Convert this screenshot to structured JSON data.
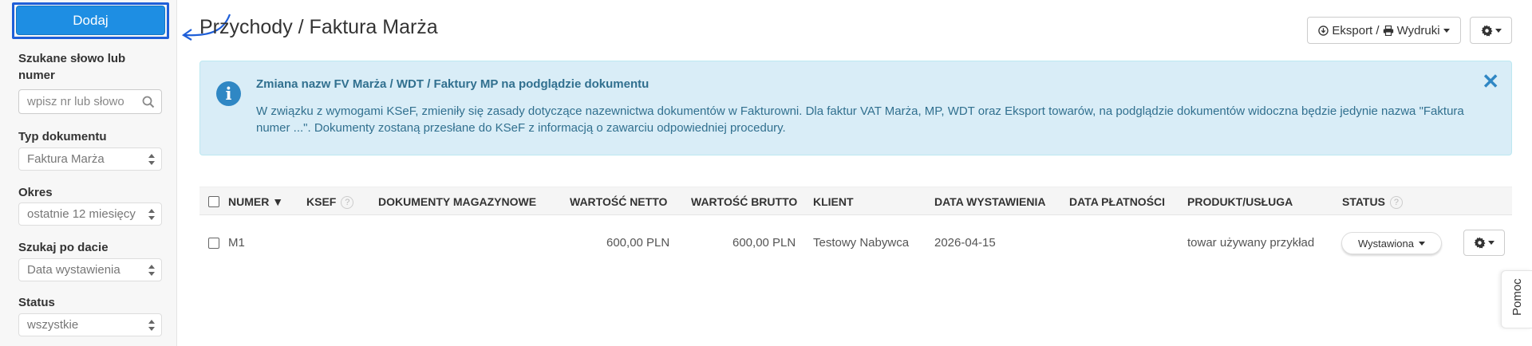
{
  "sidebar": {
    "add_label": "Dodaj",
    "search_label": "Szukane słowo lub numer",
    "search_placeholder": "wpisz nr lub słowo",
    "doc_type_label": "Typ dokumentu",
    "doc_type_value": "Faktura Marża",
    "period_label": "Okres",
    "period_value": "ostatnie 12 miesięcy",
    "date_search_label": "Szukaj po dacie",
    "date_search_value": "Data wystawienia",
    "status_label": "Status",
    "status_value": "wszystkie"
  },
  "header": {
    "title": "Przychody / Faktura Marża",
    "export_label": "Eksport / ",
    "print_label": "Wydruki"
  },
  "alert": {
    "title": "Zmiana nazw FV Marża / WDT / Faktury MP na podglądzie dokumentu",
    "body": "W związku z wymogami KSeF, zmieniły się zasady dotyczące nazewnictwa dokumentów w Fakturowni. Dla faktur VAT Marża, MP, WDT oraz Eksport towarów, na podglądzie dokumentów widoczna będzie jedynie nazwa \"Faktura numer ...\". Dokumenty zostaną przesłane do KSeF z informacją o zawarciu odpowiedniej procedury.",
    "close": "✕"
  },
  "table": {
    "headers": {
      "number": "NUMER ▼",
      "ksef": "KSEF",
      "warehouse": "DOKUMENTY MAGAZYNOWE",
      "net": "WARTOŚĆ NETTO",
      "gross": "WARTOŚĆ BRUTTO",
      "client": "KLIENT",
      "issue_date": "DATA WYSTAWIENIA",
      "payment_date": "DATA PŁATNOŚCI",
      "product": "PRODUKT/USŁUGA",
      "status": "STATUS"
    },
    "rows": [
      {
        "number": "M1",
        "net": "600,00 PLN",
        "gross": "600,00 PLN",
        "client": "Testowy Nabywca",
        "issue_date": "2026-04-15",
        "product": "towar używany przykład",
        "status": "Wystawiona"
      }
    ]
  },
  "help_tab": "Pomoc",
  "colors": {
    "primary": "#1e8ee3",
    "alert_bg": "#d9edf7",
    "alert_text": "#31708f"
  }
}
